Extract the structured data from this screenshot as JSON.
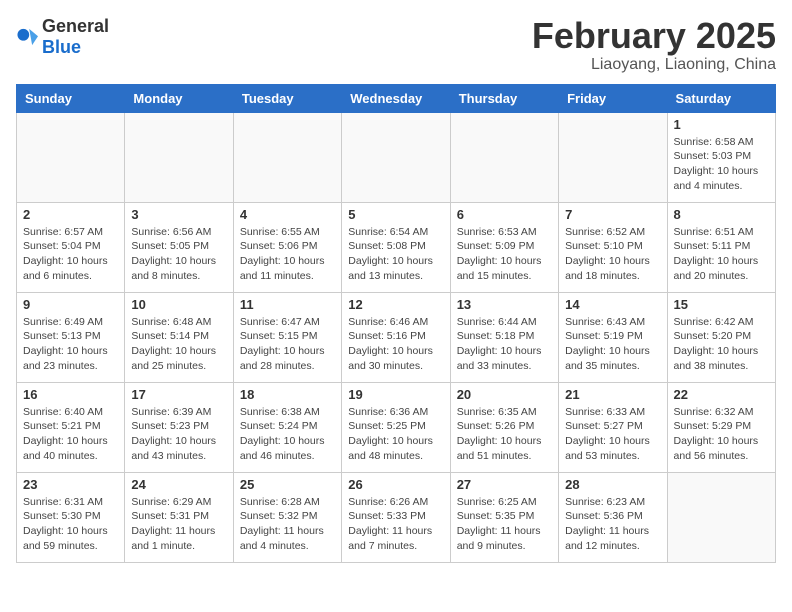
{
  "logo": {
    "text_general": "General",
    "text_blue": "Blue"
  },
  "header": {
    "month_year": "February 2025",
    "location": "Liaoyang, Liaoning, China"
  },
  "weekdays": [
    "Sunday",
    "Monday",
    "Tuesday",
    "Wednesday",
    "Thursday",
    "Friday",
    "Saturday"
  ],
  "weeks": [
    [
      {
        "day": "",
        "info": ""
      },
      {
        "day": "",
        "info": ""
      },
      {
        "day": "",
        "info": ""
      },
      {
        "day": "",
        "info": ""
      },
      {
        "day": "",
        "info": ""
      },
      {
        "day": "",
        "info": ""
      },
      {
        "day": "1",
        "info": "Sunrise: 6:58 AM\nSunset: 5:03 PM\nDaylight: 10 hours and 4 minutes."
      }
    ],
    [
      {
        "day": "2",
        "info": "Sunrise: 6:57 AM\nSunset: 5:04 PM\nDaylight: 10 hours and 6 minutes."
      },
      {
        "day": "3",
        "info": "Sunrise: 6:56 AM\nSunset: 5:05 PM\nDaylight: 10 hours and 8 minutes."
      },
      {
        "day": "4",
        "info": "Sunrise: 6:55 AM\nSunset: 5:06 PM\nDaylight: 10 hours and 11 minutes."
      },
      {
        "day": "5",
        "info": "Sunrise: 6:54 AM\nSunset: 5:08 PM\nDaylight: 10 hours and 13 minutes."
      },
      {
        "day": "6",
        "info": "Sunrise: 6:53 AM\nSunset: 5:09 PM\nDaylight: 10 hours and 15 minutes."
      },
      {
        "day": "7",
        "info": "Sunrise: 6:52 AM\nSunset: 5:10 PM\nDaylight: 10 hours and 18 minutes."
      },
      {
        "day": "8",
        "info": "Sunrise: 6:51 AM\nSunset: 5:11 PM\nDaylight: 10 hours and 20 minutes."
      }
    ],
    [
      {
        "day": "9",
        "info": "Sunrise: 6:49 AM\nSunset: 5:13 PM\nDaylight: 10 hours and 23 minutes."
      },
      {
        "day": "10",
        "info": "Sunrise: 6:48 AM\nSunset: 5:14 PM\nDaylight: 10 hours and 25 minutes."
      },
      {
        "day": "11",
        "info": "Sunrise: 6:47 AM\nSunset: 5:15 PM\nDaylight: 10 hours and 28 minutes."
      },
      {
        "day": "12",
        "info": "Sunrise: 6:46 AM\nSunset: 5:16 PM\nDaylight: 10 hours and 30 minutes."
      },
      {
        "day": "13",
        "info": "Sunrise: 6:44 AM\nSunset: 5:18 PM\nDaylight: 10 hours and 33 minutes."
      },
      {
        "day": "14",
        "info": "Sunrise: 6:43 AM\nSunset: 5:19 PM\nDaylight: 10 hours and 35 minutes."
      },
      {
        "day": "15",
        "info": "Sunrise: 6:42 AM\nSunset: 5:20 PM\nDaylight: 10 hours and 38 minutes."
      }
    ],
    [
      {
        "day": "16",
        "info": "Sunrise: 6:40 AM\nSunset: 5:21 PM\nDaylight: 10 hours and 40 minutes."
      },
      {
        "day": "17",
        "info": "Sunrise: 6:39 AM\nSunset: 5:23 PM\nDaylight: 10 hours and 43 minutes."
      },
      {
        "day": "18",
        "info": "Sunrise: 6:38 AM\nSunset: 5:24 PM\nDaylight: 10 hours and 46 minutes."
      },
      {
        "day": "19",
        "info": "Sunrise: 6:36 AM\nSunset: 5:25 PM\nDaylight: 10 hours and 48 minutes."
      },
      {
        "day": "20",
        "info": "Sunrise: 6:35 AM\nSunset: 5:26 PM\nDaylight: 10 hours and 51 minutes."
      },
      {
        "day": "21",
        "info": "Sunrise: 6:33 AM\nSunset: 5:27 PM\nDaylight: 10 hours and 53 minutes."
      },
      {
        "day": "22",
        "info": "Sunrise: 6:32 AM\nSunset: 5:29 PM\nDaylight: 10 hours and 56 minutes."
      }
    ],
    [
      {
        "day": "23",
        "info": "Sunrise: 6:31 AM\nSunset: 5:30 PM\nDaylight: 10 hours and 59 minutes."
      },
      {
        "day": "24",
        "info": "Sunrise: 6:29 AM\nSunset: 5:31 PM\nDaylight: 11 hours and 1 minute."
      },
      {
        "day": "25",
        "info": "Sunrise: 6:28 AM\nSunset: 5:32 PM\nDaylight: 11 hours and 4 minutes."
      },
      {
        "day": "26",
        "info": "Sunrise: 6:26 AM\nSunset: 5:33 PM\nDaylight: 11 hours and 7 minutes."
      },
      {
        "day": "27",
        "info": "Sunrise: 6:25 AM\nSunset: 5:35 PM\nDaylight: 11 hours and 9 minutes."
      },
      {
        "day": "28",
        "info": "Sunrise: 6:23 AM\nSunset: 5:36 PM\nDaylight: 11 hours and 12 minutes."
      },
      {
        "day": "",
        "info": ""
      }
    ]
  ]
}
